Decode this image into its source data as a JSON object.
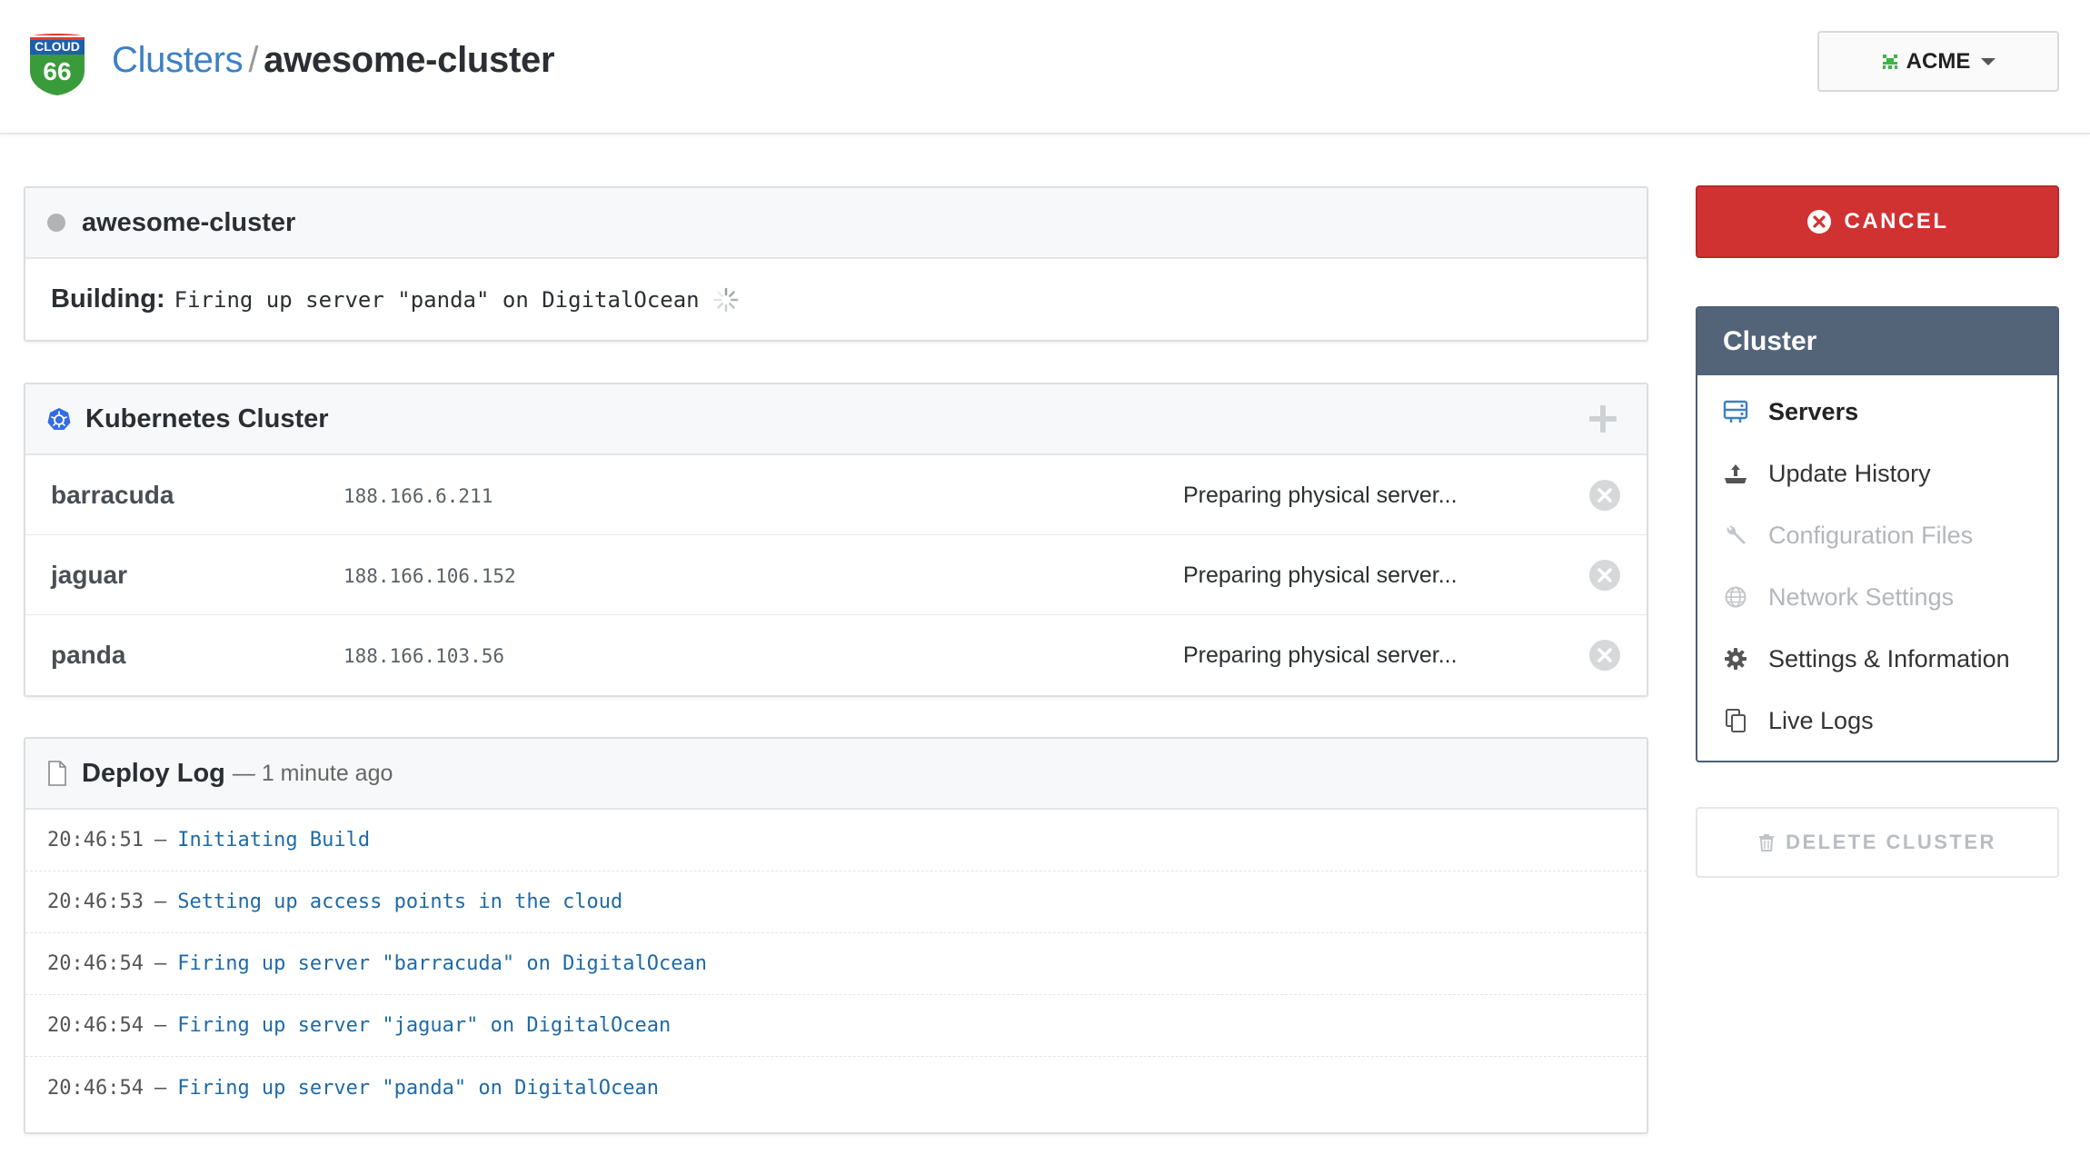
{
  "header": {
    "logo_text_top": "CLOUD",
    "logo_text_num": "66",
    "breadcrumb_link": "Clusters",
    "breadcrumb_separator": "/",
    "breadcrumb_current": "awesome-cluster",
    "account_label": "ACME"
  },
  "status_panel": {
    "title": "awesome-cluster",
    "building_label": "Building:",
    "building_message": "Firing up server \"panda\" on DigitalOcean"
  },
  "k8s_panel": {
    "title": "Kubernetes Cluster",
    "servers": [
      {
        "name": "barracuda",
        "ip": "188.166.6.211",
        "status": "Preparing physical server..."
      },
      {
        "name": "jaguar",
        "ip": "188.166.106.152",
        "status": "Preparing physical server..."
      },
      {
        "name": "panda",
        "ip": "188.166.103.56",
        "status": "Preparing physical server..."
      }
    ]
  },
  "deploy_log": {
    "title": "Deploy Log",
    "subtitle": "— 1 minute ago",
    "separator": "—",
    "entries": [
      {
        "time": "20:46:51",
        "message": "Initiating Build"
      },
      {
        "time": "20:46:53",
        "message": "Setting up access points in the cloud"
      },
      {
        "time": "20:46:54",
        "message": "Firing up server \"barracuda\" on DigitalOcean"
      },
      {
        "time": "20:46:54",
        "message": "Firing up server \"jaguar\" on DigitalOcean"
      },
      {
        "time": "20:46:54",
        "message": "Firing up server \"panda\" on DigitalOcean"
      }
    ]
  },
  "sidebar": {
    "cancel_label": "CANCEL",
    "nav_title": "Cluster",
    "items": [
      {
        "label": "Servers",
        "icon": "servers-icon",
        "state": "active"
      },
      {
        "label": "Update History",
        "icon": "update-history-icon",
        "state": "normal"
      },
      {
        "label": "Configuration Files",
        "icon": "wrench-icon",
        "state": "disabled"
      },
      {
        "label": "Network Settings",
        "icon": "globe-icon",
        "state": "disabled"
      },
      {
        "label": "Settings & Information",
        "icon": "gear-icon",
        "state": "normal"
      },
      {
        "label": "Live Logs",
        "icon": "copy-icon",
        "state": "normal"
      }
    ],
    "delete_label": "DELETE CLUSTER"
  },
  "colors": {
    "link_blue": "#3d80c4",
    "cancel_red": "#d03232",
    "nav_header": "#536479",
    "log_message": "#1f6aa5"
  }
}
